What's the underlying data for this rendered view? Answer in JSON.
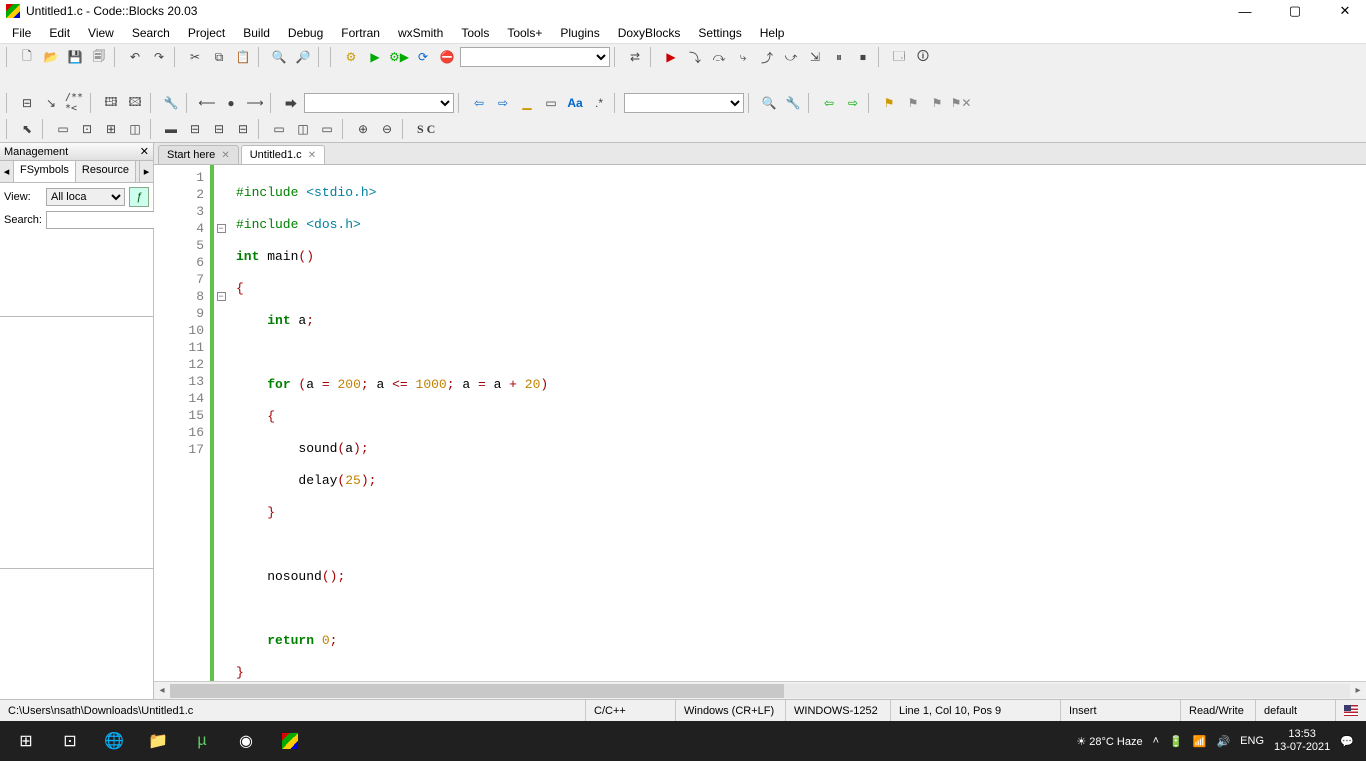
{
  "window": {
    "title": "Untitled1.c - Code::Blocks 20.03"
  },
  "menu": [
    "File",
    "Edit",
    "View",
    "Search",
    "Project",
    "Build",
    "Debug",
    "Fortran",
    "wxSmith",
    "Tools",
    "Tools+",
    "Plugins",
    "DoxyBlocks",
    "Settings",
    "Help"
  ],
  "management": {
    "title": "Management",
    "tabs": {
      "left_hidden": "◂",
      "active": "FSymbols",
      "other": "Resource",
      "right_hidden": "▸"
    },
    "view_label": "View:",
    "view_value": "All loca",
    "search_label": "Search:",
    "search_value": ""
  },
  "editor": {
    "tabs": [
      {
        "label": "Start here",
        "active": false
      },
      {
        "label": "Untitled1.c",
        "active": true
      }
    ],
    "line_numbers": [
      "1",
      "2",
      "3",
      "4",
      "5",
      "6",
      "7",
      "8",
      "9",
      "10",
      "11",
      "12",
      "13",
      "14",
      "15",
      "16",
      "17"
    ]
  },
  "code": {
    "l1a": "#include ",
    "l1b": "<stdio.h>",
    "l2a": "#include ",
    "l2b": "<dos.h>",
    "l3a": "int",
    "l3b": " main",
    "l3c": "()",
    "l4": "{",
    "l5a": "    ",
    "l5b": "int",
    "l5c": " a",
    "l5d": ";",
    "l6": "",
    "l7a": "    ",
    "l7b": "for",
    "l7c": " (",
    "l7d": "a ",
    "l7e": "=",
    "l7f": " ",
    "l7g": "200",
    "l7h": ";",
    "l7i": " a ",
    "l7j": "<=",
    "l7k": " ",
    "l7l": "1000",
    "l7m": ";",
    "l7n": " a ",
    "l7o": "=",
    "l7p": " a ",
    "l7q": "+",
    "l7r": " ",
    "l7s": "20",
    "l7t": ")",
    "l8a": "    ",
    "l8b": "{",
    "l9a": "        sound",
    "l9b": "(",
    "l9c": "a",
    "l9d": ")",
    "l9e": ";",
    "l10a": "        delay",
    "l10b": "(",
    "l10c": "25",
    "l10d": ")",
    "l10e": ";",
    "l11a": "    ",
    "l11b": "}",
    "l12": "",
    "l13a": "    nosound",
    "l13b": "()",
    "l13c": ";",
    "l14": "",
    "l15a": "    ",
    "l15b": "return",
    "l15c": " ",
    "l15d": "0",
    "l15e": ";",
    "l16": "}",
    "l17": ""
  },
  "status": {
    "filepath": "C:\\Users\\nsath\\Downloads\\Untitled1.c",
    "lang": "C/C++",
    "eol": "Windows (CR+LF)",
    "encoding": "WINDOWS-1252",
    "cursor": "Line 1, Col 10, Pos 9",
    "mode": "Insert",
    "rw": "Read/Write",
    "profile": "default"
  },
  "taskbar": {
    "weather": "28°C Haze",
    "lang": "ENG",
    "time": "13:53",
    "date": "13-07-2021"
  },
  "debugrow_text": {
    "comment1": "/** *<",
    "SC": "S  C"
  }
}
